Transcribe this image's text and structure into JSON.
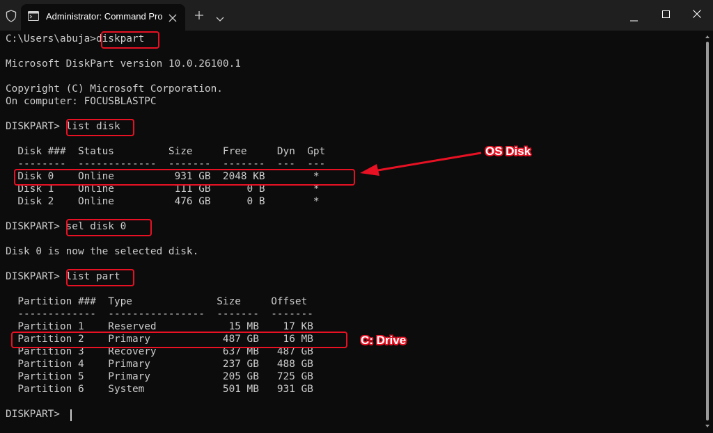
{
  "window": {
    "tab_title": "Administrator: Command Pro",
    "icons": [
      "shield-icon",
      "terminal-icon",
      "close-icon",
      "plus-icon",
      "chevron-down-icon",
      "minimize-icon",
      "maximize-icon"
    ]
  },
  "terminal": {
    "lines": [
      {
        "prompt": "C:\\Users\\abuja>",
        "command": "diskpart"
      },
      {
        "text": "Microsoft DiskPart version 10.0.26100.1"
      },
      {
        "text": "Copyright (C) Microsoft Corporation."
      },
      {
        "text": "On computer: FOCUSBLASTPC"
      },
      {
        "prompt": "DISKPART> ",
        "command": "list disk"
      },
      {
        "text": "  Disk ###  Status         Size     Free     Dyn  Gpt"
      },
      {
        "text": "  --------  -------------  -------  -------  ---  ---"
      },
      {
        "text": "  Disk 0    Online          931 GB  2048 KB        *"
      },
      {
        "text": "  Disk 1    Online          111 GB      0 B        *"
      },
      {
        "text": "  Disk 2    Online          476 GB      0 B        *"
      },
      {
        "prompt": "DISKPART> ",
        "command": "sel disk 0"
      },
      {
        "text": "Disk 0 is now the selected disk."
      },
      {
        "prompt": "DISKPART> ",
        "command": "list part"
      },
      {
        "text": "  Partition ###  Type              Size     Offset"
      },
      {
        "text": "  -------------  ----------------  -------  -------"
      },
      {
        "text": "  Partition 1    Reserved            15 MB    17 KB"
      },
      {
        "text": "  Partition 2    Primary            487 GB    16 MB"
      },
      {
        "text": "  Partition 3    Recovery           637 MB   487 GB"
      },
      {
        "text": "  Partition 4    Primary            237 GB   488 GB"
      },
      {
        "text": "  Partition 5    Primary            205 GB   725 GB"
      },
      {
        "text": "  Partition 6    System             501 MB   931 GB"
      },
      {
        "text": "DISKPART> "
      }
    ]
  },
  "annotations": {
    "os_disk_label": "OS Disk",
    "c_drive_label": "C: Drive",
    "color": "#e81123"
  }
}
